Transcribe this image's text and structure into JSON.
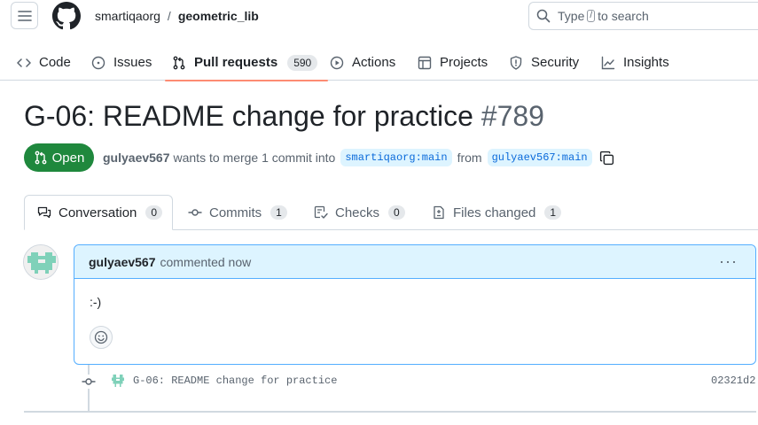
{
  "header": {
    "owner": "smartiqaorg",
    "separator": "/",
    "repo": "geometric_lib",
    "search_pre": "Type",
    "search_key": "/",
    "search_post": "to search"
  },
  "repo_nav": {
    "items": [
      {
        "label": "Code",
        "icon": "code-icon"
      },
      {
        "label": "Issues",
        "icon": "issue-opened-icon"
      },
      {
        "label": "Pull requests",
        "icon": "git-pull-request-icon",
        "count": "590",
        "selected": true
      },
      {
        "label": "Actions",
        "icon": "play-icon"
      },
      {
        "label": "Projects",
        "icon": "table-icon"
      },
      {
        "label": "Security",
        "icon": "shield-icon"
      },
      {
        "label": "Insights",
        "icon": "graph-icon"
      }
    ]
  },
  "pr": {
    "title": "G-06: README change for practice",
    "number": "#789",
    "state": "Open",
    "author": "gulyaev567",
    "merge_text": "wants to merge 1 commit into",
    "base_branch": "smartiqaorg:main",
    "from_text": "from",
    "head_branch": "gulyaev567:main"
  },
  "tabs": [
    {
      "label": "Conversation",
      "count": "0",
      "icon": "comment-discussion-icon"
    },
    {
      "label": "Commits",
      "count": "1",
      "icon": "git-commit-icon"
    },
    {
      "label": "Checks",
      "count": "0",
      "icon": "checklist-icon"
    },
    {
      "label": "Files changed",
      "count": "1",
      "icon": "file-diff-icon"
    }
  ],
  "comment": {
    "author": "gulyaev567",
    "time": "commented now",
    "body": ":-)",
    "menu": "···"
  },
  "commit": {
    "message": "G-06: README change for practice",
    "sha": "02321d2"
  },
  "colors": {
    "open_green": "#1f883d",
    "accent_blue": "#0969da",
    "header_bg": "#ddf4ff",
    "tab_underline": "#fd8c73"
  }
}
